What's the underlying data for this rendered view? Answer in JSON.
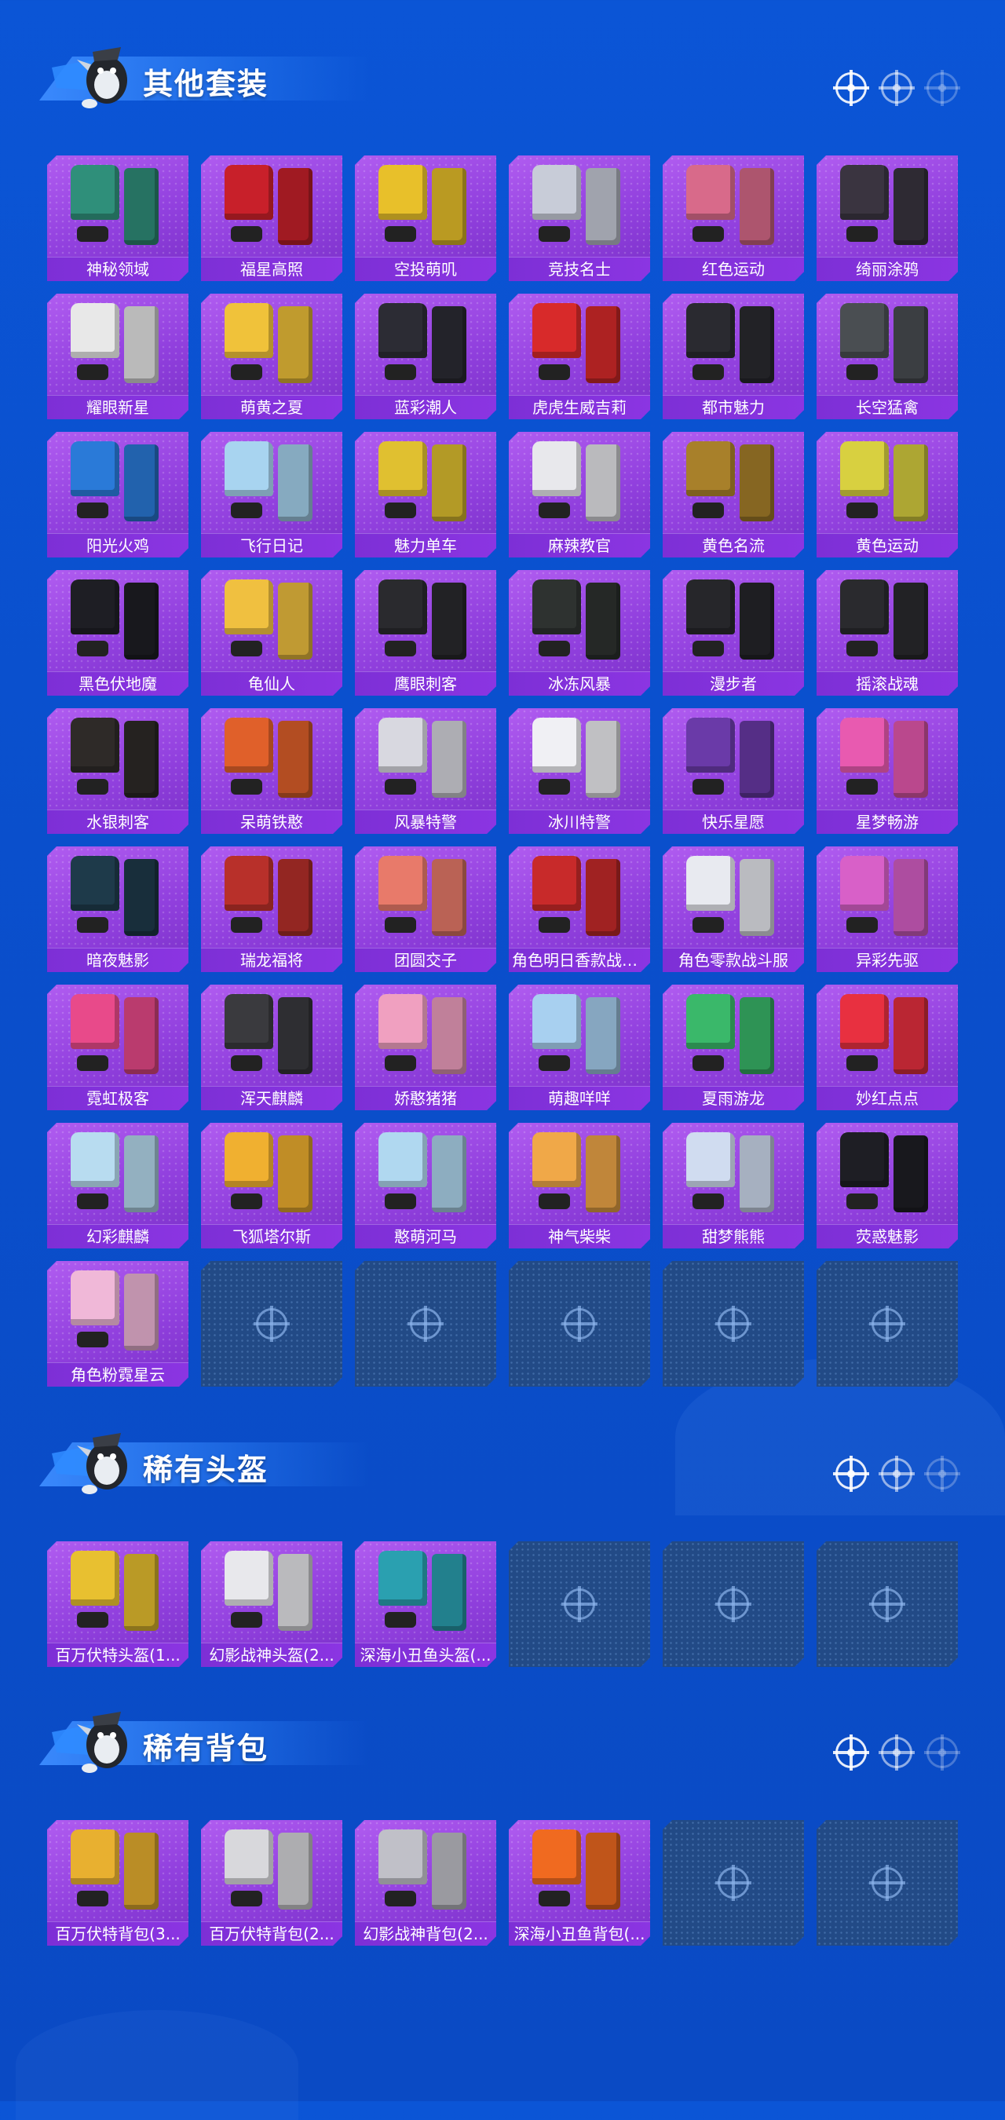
{
  "sections": [
    {
      "title": "其他套装",
      "items": [
        {
          "name": "神秘领域",
          "color": "#2f8f7a"
        },
        {
          "name": "福星高照",
          "color": "#c8202a"
        },
        {
          "name": "空投萌叽",
          "color": "#e8c02a"
        },
        {
          "name": "竞技名士",
          "color": "#c8ccd8"
        },
        {
          "name": "红色运动",
          "color": "#d86a8a"
        },
        {
          "name": "绮丽涂鸦",
          "color": "#3a3440"
        },
        {
          "name": "耀眼新星",
          "color": "#e8e8e8"
        },
        {
          "name": "萌黄之夏",
          "color": "#f0c23a"
        },
        {
          "name": "蓝彩潮人",
          "color": "#2c2c34"
        },
        {
          "name": "虎虎生威吉莉",
          "color": "#d82a2a"
        },
        {
          "name": "都市魅力",
          "color": "#2a2a30"
        },
        {
          "name": "长空猛禽",
          "color": "#4a4e52"
        },
        {
          "name": "阳光火鸡",
          "color": "#2a7ad8"
        },
        {
          "name": "飞行日记",
          "color": "#a8d4f0"
        },
        {
          "name": "魅力单车",
          "color": "#e0c030"
        },
        {
          "name": "麻辣教官",
          "color": "#e8e8ec"
        },
        {
          "name": "黄色名流",
          "color": "#a8802a"
        },
        {
          "name": "黄色运动",
          "color": "#d8d040"
        },
        {
          "name": "黑色伏地魔",
          "color": "#1e1e24"
        },
        {
          "name": "龟仙人",
          "color": "#f0c040"
        },
        {
          "name": "鹰眼刺客",
          "color": "#2a2a2e"
        },
        {
          "name": "冰冻风暴",
          "color": "#2e3230"
        },
        {
          "name": "漫步者",
          "color": "#26262a"
        },
        {
          "name": "摇滚战魂",
          "color": "#2a2a2e"
        },
        {
          "name": "水银刺客",
          "color": "#2e2a28"
        },
        {
          "name": "呆萌铁憨",
          "color": "#e0602a"
        },
        {
          "name": "风暴特警",
          "color": "#d8d8e0"
        },
        {
          "name": "冰川特警",
          "color": "#f0f0f4"
        },
        {
          "name": "快乐星愿",
          "color": "#6a3aa8"
        },
        {
          "name": "星梦畅游",
          "color": "#e85ab0"
        },
        {
          "name": "暗夜魅影",
          "color": "#1e3a4a"
        },
        {
          "name": "瑞龙福将",
          "color": "#b8302a"
        },
        {
          "name": "团圆交子",
          "color": "#e87a6a"
        },
        {
          "name": "角色明日香款战斗...",
          "color": "#c82a2a"
        },
        {
          "name": "角色零款战斗服",
          "color": "#e8eaf0"
        },
        {
          "name": "异彩先驱",
          "color": "#d860c8"
        },
        {
          "name": "霓虹极客",
          "color": "#e84a8a"
        },
        {
          "name": "浑天麒麟",
          "color": "#3a3a3e"
        },
        {
          "name": "娇憨猪猪",
          "color": "#f0a0c0"
        },
        {
          "name": "萌趣咩咩",
          "color": "#a8d0f0"
        },
        {
          "name": "夏雨游龙",
          "color": "#3ab86a"
        },
        {
          "name": "妙红点点",
          "color": "#e83040"
        },
        {
          "name": "幻彩麒麟",
          "color": "#b8dcf0"
        },
        {
          "name": "飞狐塔尔斯",
          "color": "#f0b030"
        },
        {
          "name": "憨萌河马",
          "color": "#b0d8f0"
        },
        {
          "name": "神气柴柴",
          "color": "#f0a848"
        },
        {
          "name": "甜梦熊熊",
          "color": "#d0dcf0"
        },
        {
          "name": "荧惑魅影",
          "color": "#1e1e24"
        },
        {
          "name": "角色粉霓星云",
          "color": "#f0b8d8"
        }
      ],
      "empty_slots": 5
    },
    {
      "title": "稀有头盔",
      "items": [
        {
          "name": "百万伏特头盔(1...",
          "color": "#e8c030"
        },
        {
          "name": "幻影战神头盔(2...",
          "color": "#e8e8ec"
        },
        {
          "name": "深海小丑鱼头盔(...",
          "color": "#2aa0b0"
        }
      ],
      "empty_slots": 3
    },
    {
      "title": "稀有背包",
      "items": [
        {
          "name": "百万伏特背包(3...",
          "color": "#e8b030"
        },
        {
          "name": "百万伏特背包(2...",
          "color": "#d8d8dc"
        },
        {
          "name": "幻影战神背包(2...",
          "color": "#c0c0c8"
        },
        {
          "name": "深海小丑鱼背包(...",
          "color": "#f06a20"
        }
      ],
      "empty_slots": 2
    }
  ]
}
